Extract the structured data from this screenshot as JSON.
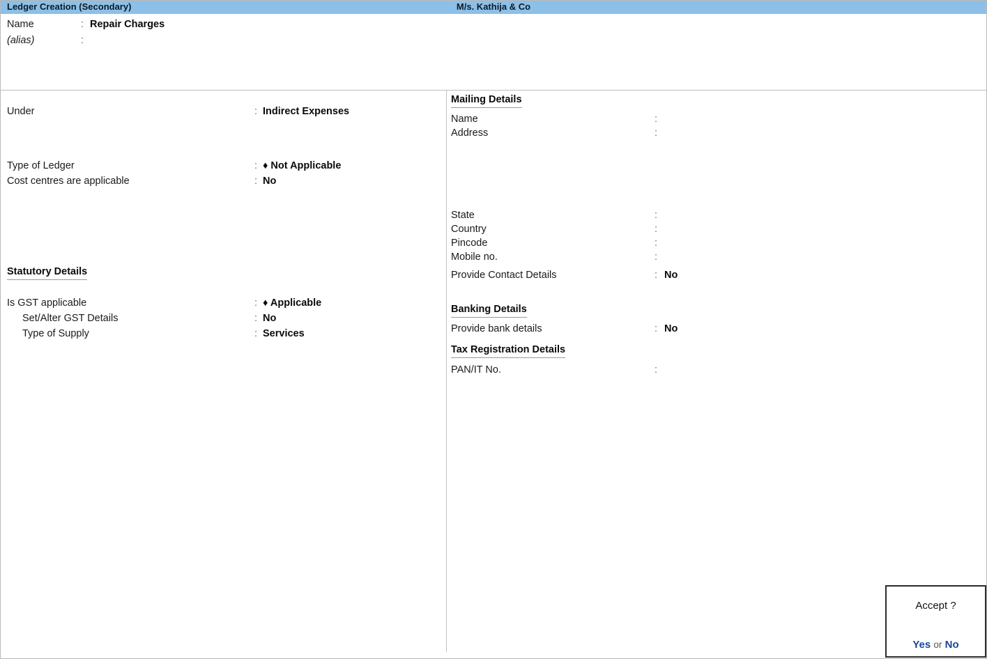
{
  "titlebar": {
    "screen_title": "Ledger Creation (Secondary)",
    "company_name": "M/s. Kathija & Co",
    "background_color": "#8CC0E8"
  },
  "name_block": {
    "name_label": "Name",
    "name_colon": ":",
    "name_value": "Repair Charges",
    "alias_label": "(alias)",
    "alias_colon": ":",
    "alias_value": ""
  },
  "left_panel": {
    "under": {
      "label": "Under",
      "colon": ":",
      "value": "Indirect Expenses"
    },
    "type_of_ledger": {
      "label": "Type of Ledger",
      "colon": ":",
      "value": "♦ Not Applicable"
    },
    "cost_centres": {
      "label": "Cost centres are applicable",
      "colon": ":",
      "value": "No"
    },
    "statutory_heading": "Statutory Details",
    "is_gst_applicable": {
      "label": "Is GST applicable",
      "colon": ":",
      "value": "♦ Applicable"
    },
    "set_alter_gst": {
      "label": "Set/Alter GST Details",
      "colon": ":",
      "value": "No"
    },
    "type_of_supply": {
      "label": "Type of Supply",
      "colon": ":",
      "value": "Services"
    }
  },
  "right_panel": {
    "mailing_heading": "Mailing Details",
    "mailing_name": {
      "label": "Name",
      "colon": ":",
      "value": ""
    },
    "mailing_address": {
      "label": "Address",
      "colon": ":",
      "value": ""
    },
    "state": {
      "label": "State",
      "colon": ":",
      "value": ""
    },
    "country": {
      "label": "Country",
      "colon": ":",
      "value": ""
    },
    "pincode": {
      "label": "Pincode",
      "colon": ":",
      "value": ""
    },
    "mobile_no": {
      "label": "Mobile no.",
      "colon": ":",
      "value": ""
    },
    "provide_contact_details": {
      "label": "Provide Contact Details",
      "colon": ":",
      "value": "No"
    },
    "banking_heading": "Banking Details",
    "provide_bank_details": {
      "label": "Provide bank details",
      "colon": ":",
      "value": "No"
    },
    "tax_registration_heading": "Tax Registration Details",
    "pan_it_no": {
      "label": "PAN/IT No.",
      "colon": ":",
      "value": ""
    }
  },
  "accept_dialog": {
    "title": "Accept ?",
    "yes_label": "Yes",
    "or_label": "or",
    "no_label": "No",
    "link_color": "#15489B"
  }
}
